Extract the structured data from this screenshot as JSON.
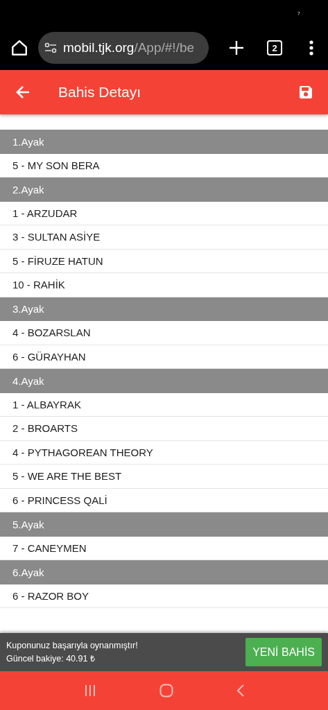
{
  "status_bar": {
    "indicator": "7"
  },
  "browser": {
    "url_host": "mobil.tjk.org",
    "url_path": "/App/#!/be",
    "tab_count": "2"
  },
  "app_bar": {
    "title": "Bahis Detayı"
  },
  "legs": [
    {
      "title": "1.Ayak",
      "horses": [
        "5 - MY SON BERA"
      ]
    },
    {
      "title": "2.Ayak",
      "horses": [
        "1 - ARZUDAR",
        "3 - SULTAN ASİYE",
        "5 - FİRUZE HATUN",
        "10 - RAHİK"
      ]
    },
    {
      "title": "3.Ayak",
      "horses": [
        "4 - BOZARSLAN",
        "6 - GÜRAYHAN"
      ]
    },
    {
      "title": "4.Ayak",
      "horses": [
        "1 - ALBAYRAK",
        "2 - BROARTS",
        "4 - PYTHAGOREAN THEORY",
        "5 - WE ARE THE BEST",
        "6 - PRINCESS QALİ"
      ]
    },
    {
      "title": "5.Ayak",
      "horses": [
        "7 - CANEYMEN"
      ]
    },
    {
      "title": "6.Ayak",
      "horses": [
        "6 - RAZOR BOY"
      ]
    }
  ],
  "snackbar": {
    "message": "Kuponunuz başarıyla oynanmıştır!",
    "balance": "Güncel bakiye: 40.91 ₺",
    "action": "YENİ BAHİS"
  }
}
